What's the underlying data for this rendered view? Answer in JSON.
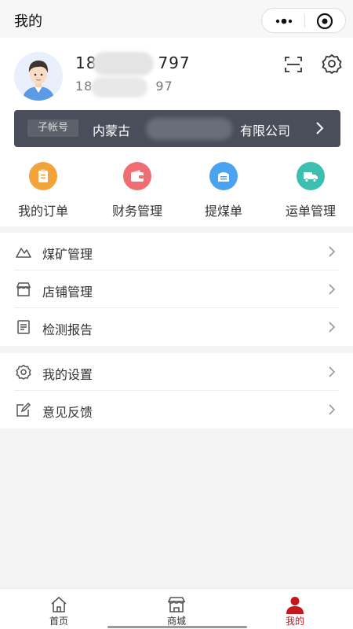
{
  "app": {
    "title": "我的"
  },
  "profile": {
    "phone_primary": "18",
    "phone_primary_suffix": "797",
    "phone_secondary": "18",
    "phone_secondary_suffix": "97"
  },
  "sub_account": {
    "tag": "子帐号",
    "company_prefix": "内蒙古",
    "company_suffix": "有限公司"
  },
  "shortcuts": [
    {
      "label": "我的订单",
      "color": "#f2a33a",
      "icon": "clipboard-icon"
    },
    {
      "label": "财务管理",
      "color": "#ee6e73",
      "icon": "wallet-icon"
    },
    {
      "label": "提煤单",
      "color": "#4aa3f0",
      "icon": "coal-receipt-icon"
    },
    {
      "label": "运单管理",
      "color": "#3cbfb0",
      "icon": "truck-icon"
    }
  ],
  "menu_group_1": [
    {
      "label": "煤矿管理",
      "icon": "mountain-icon"
    },
    {
      "label": "店铺管理",
      "icon": "store-icon"
    },
    {
      "label": "检测报告",
      "icon": "report-icon"
    }
  ],
  "menu_group_2": [
    {
      "label": "我的设置",
      "icon": "gear-icon"
    },
    {
      "label": "意见反馈",
      "icon": "feedback-icon"
    }
  ],
  "tabs": [
    {
      "label": "首页",
      "icon": "home-icon",
      "active": false
    },
    {
      "label": "商城",
      "icon": "store-icon",
      "active": false
    },
    {
      "label": "我的",
      "icon": "user-icon",
      "active": true
    }
  ],
  "colors": {
    "active_tab": "#c8161d",
    "subbar_bg": "#4a4e5a"
  }
}
